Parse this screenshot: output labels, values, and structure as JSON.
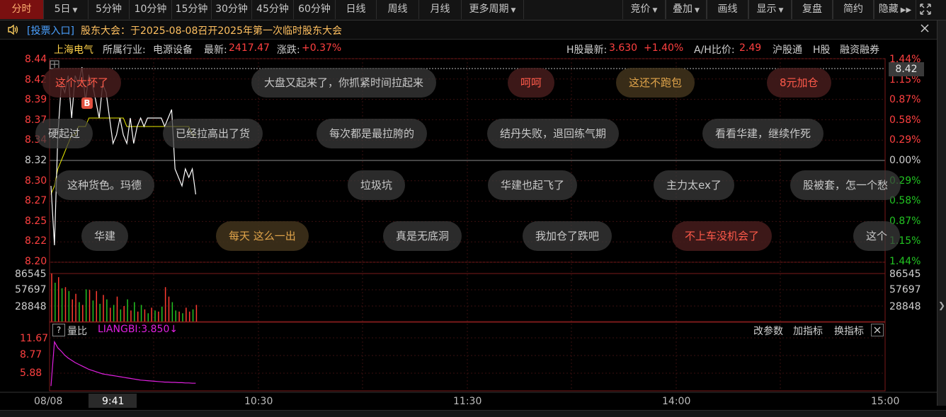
{
  "toolbar": {
    "tabs": [
      {
        "label": "分时",
        "active": true
      },
      {
        "label": "5日",
        "caret": true
      },
      {
        "label": "5分钟"
      },
      {
        "label": "10分钟"
      },
      {
        "label": "15分钟"
      },
      {
        "label": "30分钟"
      },
      {
        "label": "45分钟"
      },
      {
        "label": "60分钟"
      },
      {
        "label": "日线"
      },
      {
        "label": "周线"
      },
      {
        "label": "月线"
      },
      {
        "label": "更多周期",
        "caret": true
      }
    ],
    "right": [
      {
        "label": "竞价",
        "caret": true
      },
      {
        "label": "叠加",
        "caret": true
      },
      {
        "label": "画线"
      },
      {
        "label": "显示",
        "caret": true
      },
      {
        "label": "复盘"
      },
      {
        "label": "简约"
      },
      {
        "label": "隐藏"
      }
    ]
  },
  "notice": {
    "link": "[投票入口]",
    "text": "股东大会：于2025-08-08召开2025年第一次临时股东大会"
  },
  "info": {
    "name": "上海电气",
    "industry_label": "所属行业:",
    "industry": "电源设备",
    "latest_label": "最新:",
    "latest": "2417.47",
    "change_label": "涨跌:",
    "change": "+0.37%",
    "h_label": "H股最新:",
    "h_price": "3.630",
    "h_change": "+1.40%",
    "ah_label": "A/H比价:",
    "ah_value": "2.49",
    "link1": "沪股通",
    "link2": "H股",
    "link3": "融资融券"
  },
  "price_axis": [
    "8.44",
    "8.42",
    "8.39",
    "8.37",
    "8.34",
    "8.32",
    "8.30",
    "8.27",
    "8.25",
    "8.22",
    "8.20"
  ],
  "pct_axis": [
    "1.44%",
    "1.15%",
    "0.87%",
    "0.58%",
    "0.29%",
    "0.00%",
    "0.29%",
    "0.58%",
    "0.87%",
    "1.15%",
    "1.44%"
  ],
  "cursor_price": "8.42",
  "b_marker": "B",
  "bubbles": [
    {
      "text": "这个太坏了",
      "style": "red"
    },
    {
      "text": "大盘又起来了，你抓紧时间拉起来",
      "style": "normal"
    },
    {
      "text": "呵呵",
      "style": "red"
    },
    {
      "text": "这还不跑包",
      "style": "gold"
    },
    {
      "text": "8元加仓",
      "style": "red"
    },
    {
      "text": "硬起过",
      "style": "normal"
    },
    {
      "text": "已经拉高出了货",
      "style": "normal"
    },
    {
      "text": "每次都是最拉胯的",
      "style": "normal"
    },
    {
      "text": "结丹失败，退回练气期",
      "style": "normal"
    },
    {
      "text": "看看华建，继续作死",
      "style": "normal"
    },
    {
      "text": "这种货色。玛德",
      "style": "normal"
    },
    {
      "text": "垃圾坑",
      "style": "normal"
    },
    {
      "text": "华建也起飞了",
      "style": "normal"
    },
    {
      "text": "主力太ex了",
      "style": "normal"
    },
    {
      "text": "股被套，怎一个愁",
      "style": "normal"
    },
    {
      "text": "华建",
      "style": "normal"
    },
    {
      "text": "每天 这么一出",
      "style": "gold"
    },
    {
      "text": "真是无底洞",
      "style": "normal"
    },
    {
      "text": "我加仓了跌吧",
      "style": "normal"
    },
    {
      "text": "不上车没机会了",
      "style": "red"
    },
    {
      "text": "这个",
      "style": "normal"
    }
  ],
  "volume_axis": [
    "86545",
    "57697",
    "28848"
  ],
  "indicator": {
    "help": "?",
    "name": "量比",
    "value_label": "LIANGBI:3.850↓",
    "axis": [
      "11.67",
      "8.77",
      "5.88"
    ],
    "buttons": [
      "改参数",
      "加指标",
      "换指标"
    ]
  },
  "time_axis": [
    "08/08",
    "9:41",
    "10:30",
    "11:30",
    "14:00",
    "15:00"
  ],
  "colors": {
    "up": "#ff3b30",
    "down": "#22c422",
    "price_line": "#ffffff",
    "avg_line": "#e8e800",
    "indicator_line": "#e020e0",
    "accent": "#ffb070"
  },
  "chart_data": {
    "type": "line",
    "price_range": [
      8.2,
      8.44
    ],
    "pct_range": [
      -1.44,
      1.44
    ],
    "price_series": [
      8.29,
      8.22,
      8.35,
      8.41,
      8.4,
      8.42,
      8.37,
      8.42,
      8.41,
      8.43,
      8.39,
      8.42,
      8.41,
      8.39,
      8.37,
      8.41,
      8.4,
      8.37,
      8.34,
      8.35,
      8.37,
      8.35,
      8.34,
      8.37,
      8.34,
      8.36,
      8.37,
      8.36,
      8.37,
      8.37,
      8.37,
      8.37,
      8.37,
      8.36,
      8.37,
      8.38,
      8.31,
      8.3,
      8.29,
      8.31,
      8.3,
      8.31,
      8.28
    ],
    "avg_series": [
      8.28,
      8.29,
      8.31,
      8.32,
      8.33,
      8.34,
      8.35,
      8.35,
      8.36,
      8.36,
      8.36,
      8.37,
      8.37,
      8.37,
      8.37,
      8.37,
      8.37,
      8.37,
      8.37,
      8.37,
      8.37,
      8.37,
      8.36,
      8.36,
      8.36,
      8.36,
      8.36,
      8.36,
      8.36,
      8.36,
      8.36,
      8.36,
      8.36,
      8.36,
      8.36,
      8.36,
      8.36,
      8.36,
      8.36,
      8.36,
      8.36,
      8.35,
      8.35
    ],
    "volume_range": [
      0,
      86545
    ],
    "volumes": [
      86545,
      70000,
      80000,
      60000,
      62000,
      55000,
      40000,
      50000,
      35000,
      30000,
      58000,
      57000,
      38000,
      55000,
      32000,
      48000,
      40000,
      25000,
      30000,
      45000,
      22000,
      28000,
      40000,
      20000,
      35000,
      18000,
      30000,
      22000,
      15000,
      25000,
      20000,
      18000,
      27000,
      62000,
      45000,
      35000,
      20000,
      18000,
      15000,
      25000,
      18000,
      22000,
      30000
    ],
    "volume_up": [
      true,
      false,
      true,
      false,
      true,
      false,
      true,
      true,
      false,
      true,
      false,
      true,
      false,
      true,
      false,
      true,
      false,
      true,
      false,
      true,
      false,
      true,
      false,
      true,
      false,
      true,
      false,
      true,
      false,
      true,
      false,
      true,
      false,
      true,
      true,
      false,
      false,
      true,
      false,
      true,
      true,
      false,
      true
    ],
    "liangbi_range": [
      3.0,
      12.5
    ],
    "liangbi": [
      3.85,
      11.67,
      10.6,
      10.0,
      9.3,
      8.8,
      8.4,
      8.0,
      7.7,
      7.4,
      7.1,
      6.8,
      6.6,
      6.4,
      6.2,
      6.0,
      5.9,
      5.8,
      5.7,
      5.6,
      5.5,
      5.4,
      5.3,
      5.2,
      5.1,
      5.0,
      4.9,
      4.85,
      4.8,
      4.75,
      4.7,
      4.65,
      4.6,
      4.55,
      4.55,
      4.5,
      4.5,
      4.45,
      4.45,
      4.4,
      4.4,
      4.35,
      4.35
    ],
    "session_points": 241
  }
}
